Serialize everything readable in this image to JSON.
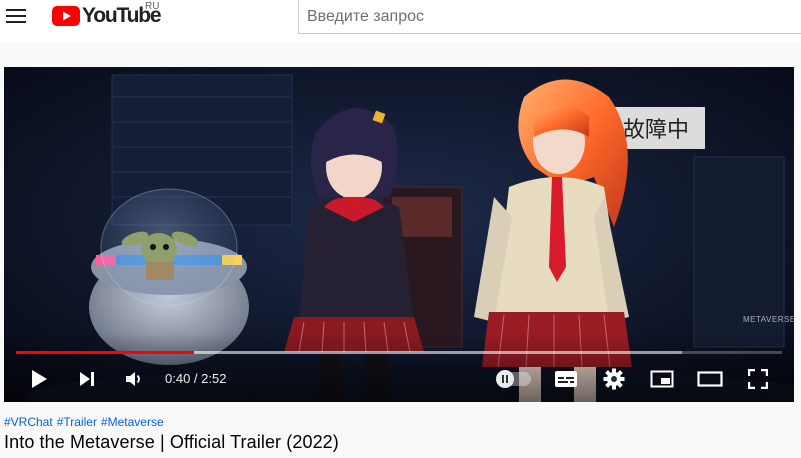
{
  "header": {
    "logo_text": "YouTube",
    "country_code": "RU",
    "search_placeholder": "Введите запрос"
  },
  "player": {
    "current_time": "0:40",
    "duration": "2:52",
    "time_display": "0:40 / 2:52",
    "progress_played": 0.233,
    "progress_buffered": 0.87,
    "autoplay_on": false,
    "watermark": "METAVERSE",
    "sign_text": "故障中",
    "colors": {
      "progress": "#ff0000",
      "brand": "#ff0000"
    },
    "icons": [
      "play-icon",
      "next-icon",
      "volume-icon",
      "autoplay-toggle",
      "subtitles-icon",
      "settings-gear-icon",
      "miniplayer-icon",
      "theater-mode-icon",
      "fullscreen-icon"
    ]
  },
  "video": {
    "hashtags": [
      "#VRChat",
      "#Trailer",
      "#Metaverse"
    ],
    "title": "Into the Metaverse | Official Trailer (2022)"
  },
  "colors": {
    "link": "#065fd4",
    "title": "#030303"
  }
}
